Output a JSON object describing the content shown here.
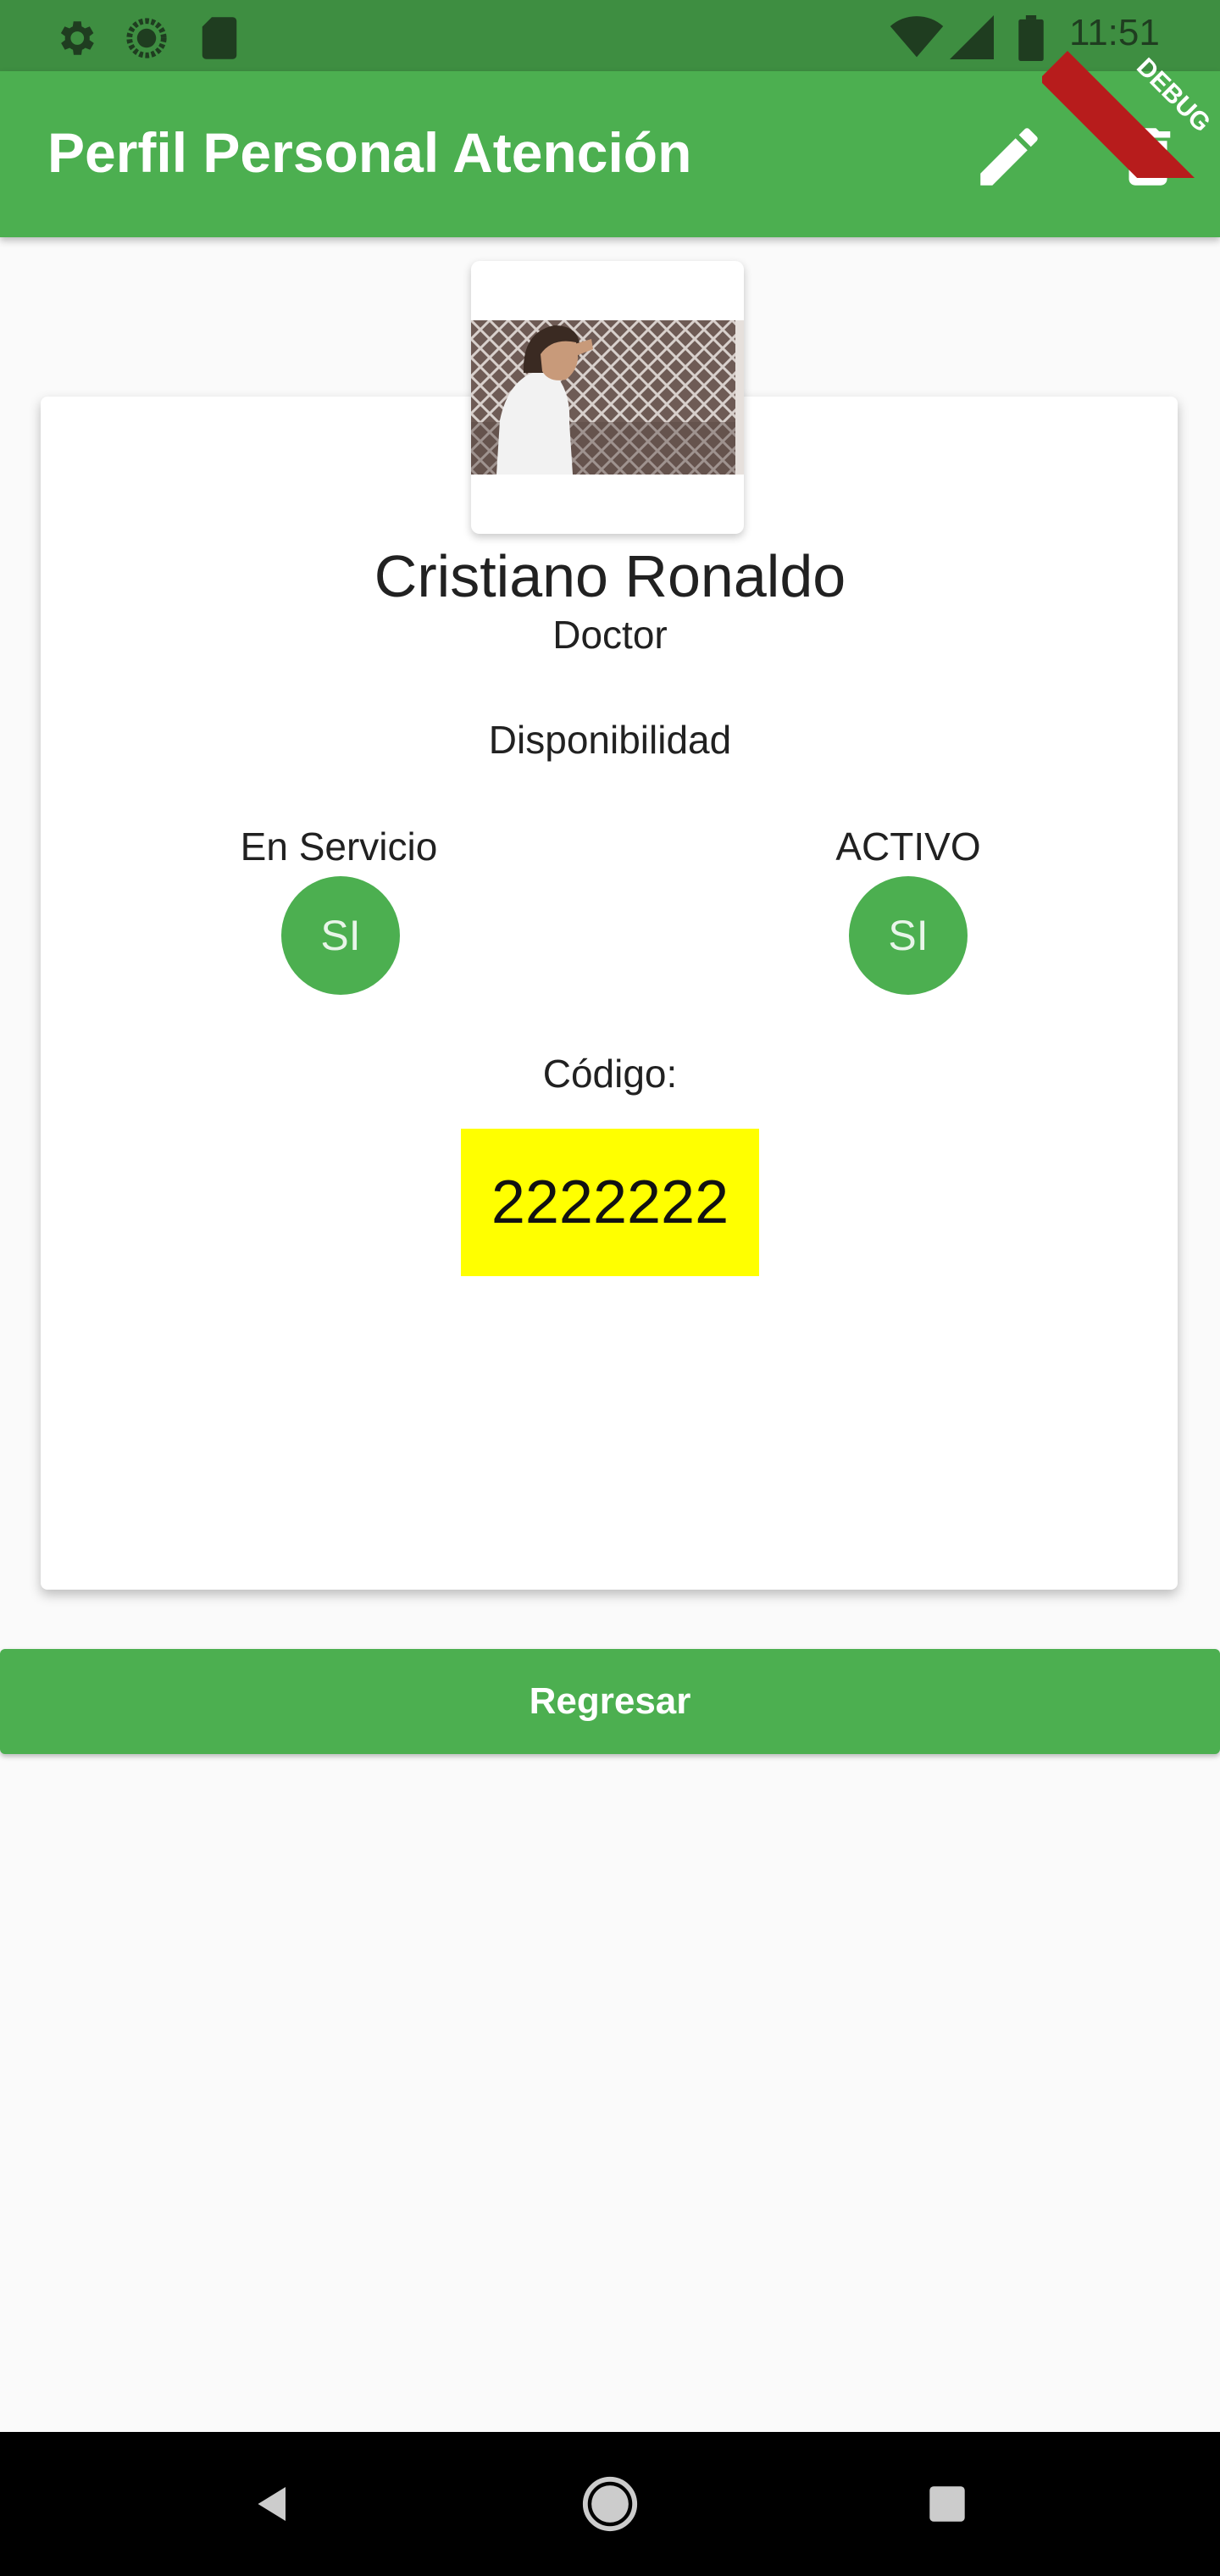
{
  "status_bar": {
    "time": "11:51",
    "icons": [
      "settings-icon",
      "sync-icon",
      "sd-card-icon",
      "wifi-icon",
      "signal-icon",
      "battery-icon"
    ]
  },
  "app_bar": {
    "title": "Perfil Personal Atención",
    "actions": [
      "edit-icon",
      "delete-icon"
    ],
    "debug_label": "DEBUG"
  },
  "profile": {
    "photo": "profile-photo",
    "name": "Cristiano Ronaldo",
    "role": "Doctor",
    "availability_label": "Disponibilidad",
    "in_service_label": "En Servicio",
    "in_service_value": "SI",
    "active_label": "ACTIVO",
    "active_value": "SI",
    "code_label": "Código:",
    "code_value": "2222222"
  },
  "back_button": {
    "label": "Regresar"
  },
  "nav_bar": {
    "buttons": [
      "back-icon",
      "home-icon",
      "recents-icon"
    ]
  },
  "colors": {
    "primary": "#4caf50",
    "status_bar": "#3e8e41",
    "code_highlight": "#ffff00",
    "background": "#fafafa"
  }
}
